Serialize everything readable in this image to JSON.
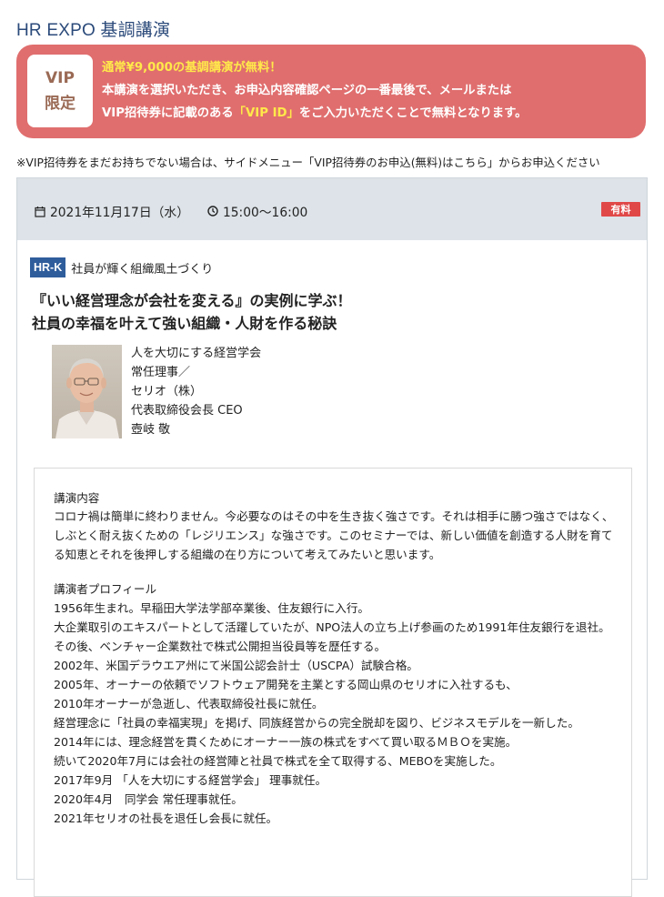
{
  "page_title": "HR EXPO 基調講演",
  "vip_banner": {
    "badge_line1": "VIP",
    "badge_line2": "限定",
    "headline": "通常¥9,000の基調講演が無料！",
    "line2": "本講演を選択いただき、お申込内容確認ページの一番最後で、メールまたは",
    "line3_pre": "VIP招待券に記載のある",
    "line3_hl": "「VIP ID」",
    "line3_post": "をご入力いただくことで無料となります。"
  },
  "note": "※VIP招待券をまだお持ちでない場合は、サイドメニュー「VIP招待券のお申込(無料)はこちら」からお申込ください",
  "session": {
    "date": "2021年11月17日（水）",
    "time": "15:00〜16:00",
    "price_badge": "有料",
    "track_code": "HR-K",
    "track_name": "社員が輝く組織風土づくり",
    "title_line1": "『いい経営理念が会社を変える』の実例に学ぶ！",
    "title_line2": "社員の幸福を叶えて強い組織・人財を作る秘訣",
    "speaker": {
      "org1": "人を大切にする経営学会",
      "role1": "常任理事／",
      "org2": "セリオ（株）",
      "role2": "代表取締役会長 CEO",
      "name": "壺岐 敬"
    },
    "content_label": "講演内容",
    "content_text": "コロナ禍は簡単に終わりません。今必要なのはその中を生き抜く強さです。それは相手に勝つ強さではなく、しぶとく耐え抜くための「レジリエンス」な強さです。このセミナーでは、新しい価値を創造する人財を育てる知恵とそれを後押しする組織の在り方について考えてみたいと思います。",
    "profile_label": "講演者プロフィール",
    "profile_lines": [
      "1956年生まれ。早稲田大学法学部卒業後、住友銀行に入行。",
      "大企業取引のエキスパートとして活躍していたが、NPO法人の立ち上げ参画のため1991年住友銀行を退社。",
      "その後、ベンチャー企業数社で株式公開担当役員等を歴任する。",
      "2002年、米国デラウエア州にて米国公認会計士（USCPA）試験合格。",
      "2005年、オーナーの依頼でソフトウェア開発を主業とする岡山県のセリオに入社するも、",
      "2010年オーナーが急逝し、代表取締役社長に就任。",
      "経営理念に「社員の幸福実現」を掲げ、同族経営からの完全脱却を図り、ビジネスモデルを一新した。",
      "2014年には、理念経営を貫くためにオーナー一族の株式をすべて買い取るＭＢＯを実施。",
      "続いて2020年7月には会社の経営陣と社員で株式を全て取得する、MEBOを実施した。",
      "2017年9月 「人を大切にする経営学会」 理事就任。",
      "2020年4月　同学会 常任理事就任。",
      "2021年セリオの社長を退任し会長に就任。"
    ]
  },
  "colors": {
    "title_blue": "#2b4a7a",
    "banner_red": "#e06e6e",
    "highlight_yellow": "#ffe94a",
    "header_gray": "#dde3e8",
    "badge_red": "#e04848",
    "track_blue": "#2f5d9c"
  },
  "icons": {
    "date": "calendar-icon",
    "time": "clock-icon"
  }
}
